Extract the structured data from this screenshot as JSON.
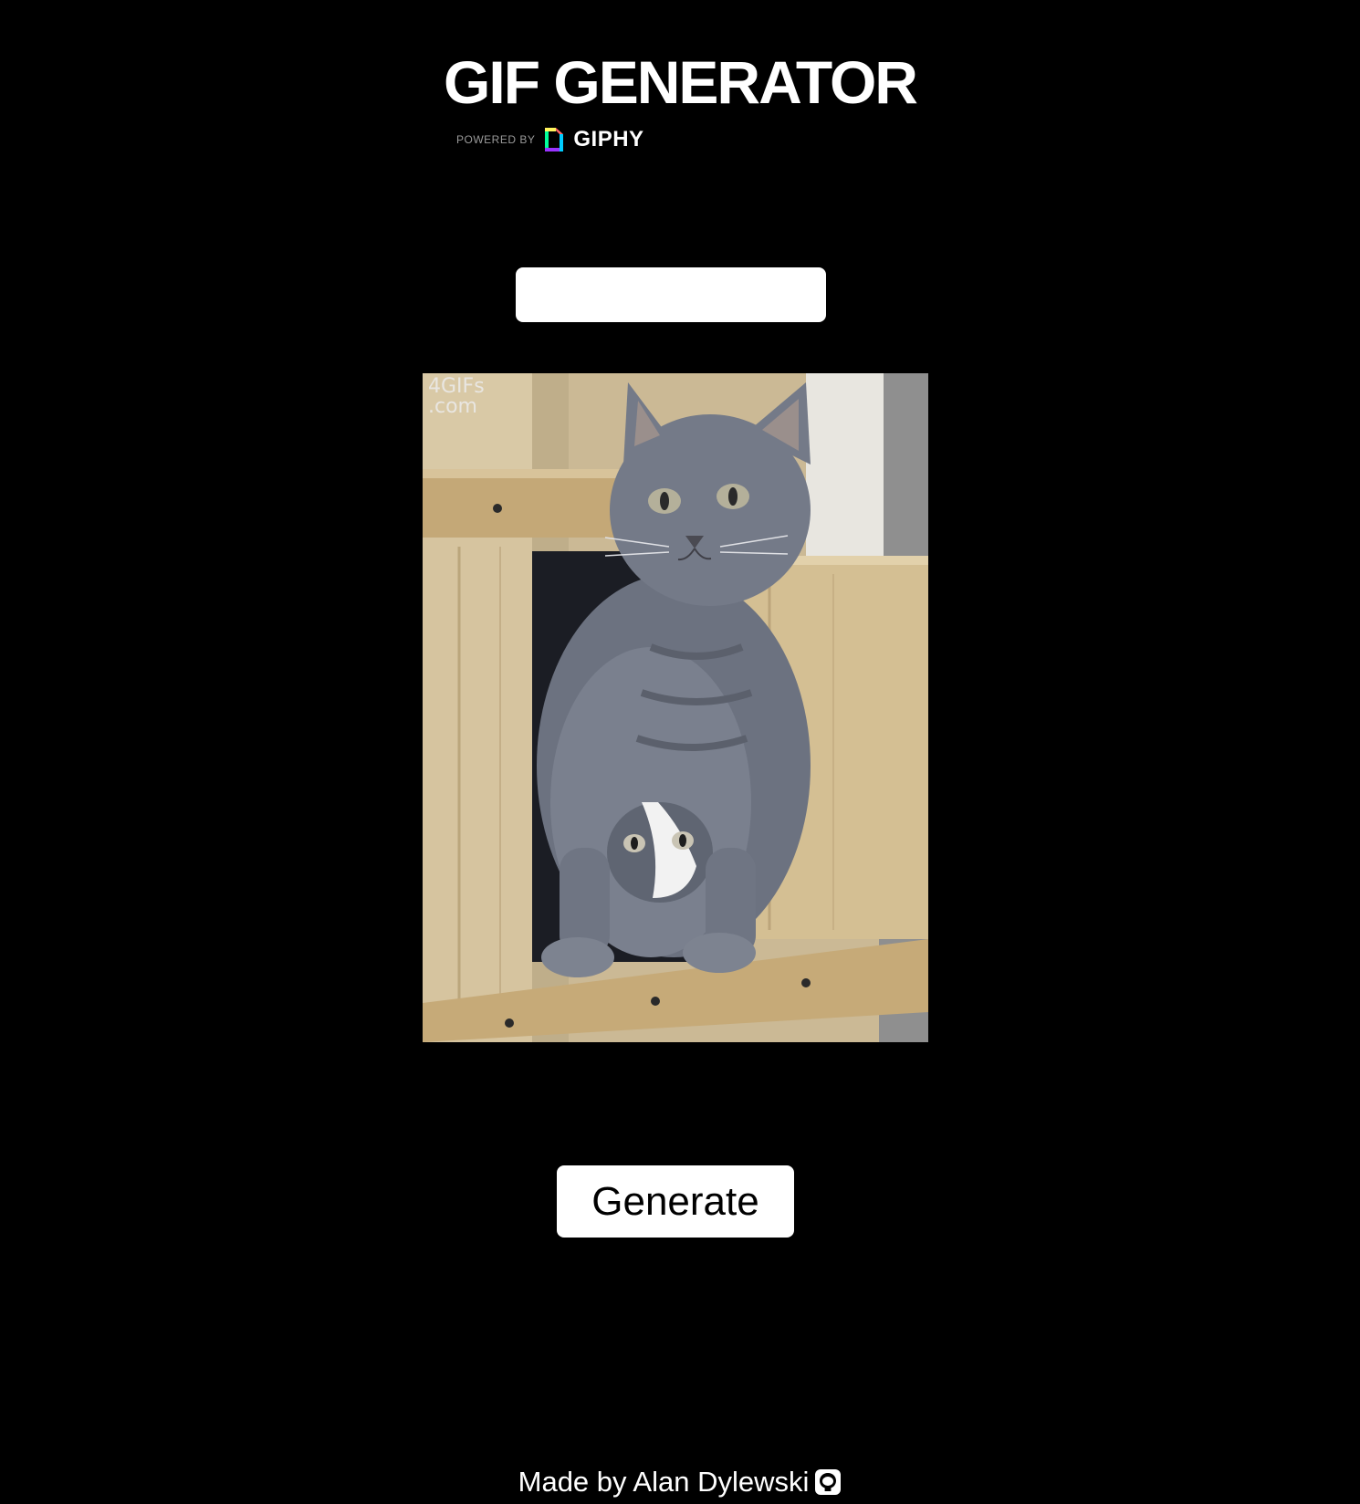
{
  "header": {
    "title": "GIF GENERATOR",
    "powered_by": "POWERED BY",
    "brand": "GIPHY",
    "brand_icon": "giphy-logo-icon"
  },
  "search": {
    "value": "",
    "placeholder": ""
  },
  "gif": {
    "watermark": "4GIFs\n.com"
  },
  "actions": {
    "generate_label": "Generate"
  },
  "footer": {
    "text": "Made by Alan Dylewski",
    "icon": "github-icon"
  },
  "colors": {
    "background": "#000000",
    "text": "#ffffff",
    "button_bg": "#ffffff",
    "button_text": "#000000"
  }
}
